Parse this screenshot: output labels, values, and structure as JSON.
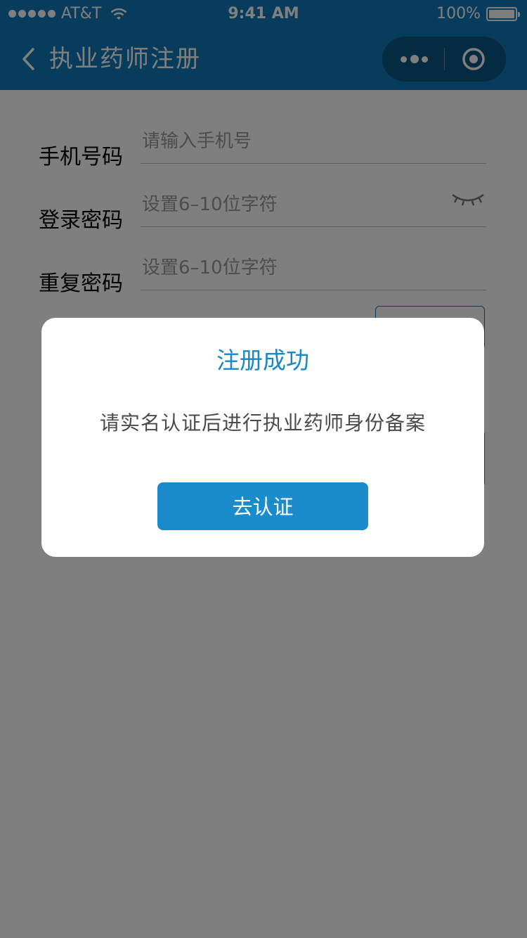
{
  "status_bar": {
    "carrier": "AT&T",
    "time": "9:41 AM",
    "battery": "100%"
  },
  "nav": {
    "title": "执业药师注册"
  },
  "form": {
    "phone": {
      "label": "手机号码",
      "placeholder": "请输入手机号"
    },
    "password": {
      "label": "登录密码",
      "placeholder": "设置6–10位字符"
    },
    "repeat_password": {
      "label": "重复密码",
      "placeholder": "设置6–10位字符"
    }
  },
  "modal": {
    "title": "注册成功",
    "message": "请实名认证后进行执业药师身份备案",
    "button_label": "去认证"
  },
  "colors": {
    "brand": "#0f78b8",
    "modal_title": "#1a87c7",
    "modal_button": "#1a8ccc"
  }
}
